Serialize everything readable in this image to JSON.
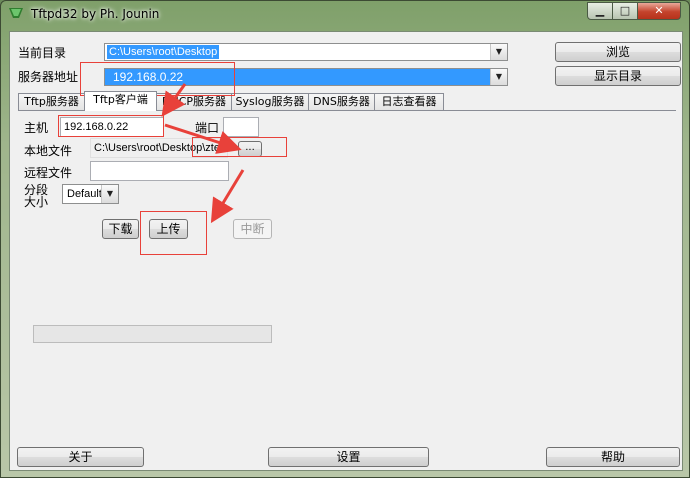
{
  "window": {
    "title": "Tftpd32 by Ph. Jounin"
  },
  "titlebar": {
    "minimize": "▁",
    "maximize": "□",
    "close": "✕"
  },
  "colors": {
    "selection": "#3399ff",
    "annotation": "#e8413a"
  },
  "top": {
    "current_dir_label": "当前目录",
    "current_dir_value": "C:\\Users\\root\\Desktop",
    "server_addr_label": "服务器地址",
    "server_addr_value": "192.168.0.22",
    "browse_label": "浏览",
    "show_dir_label": "显示目录"
  },
  "tabs": [
    "Tftp服务器",
    "Tftp客户端",
    "DHCP服务器",
    "Syslog服务器",
    "DNS服务器",
    "日志查看器"
  ],
  "client": {
    "host_label": "主机",
    "host_value": "192.168.0.22",
    "port_label": "端口",
    "port_value": "",
    "local_file_label": "本地文件",
    "local_file_value": "C:\\Users\\root\\Desktop\\zte.h",
    "browse_dots": "...",
    "remote_file_label": "远程文件",
    "remote_file_value": "",
    "block_label_1": "分段",
    "block_label_2": "大小",
    "block_value": "Default",
    "download_label": "下载",
    "upload_label": "上传",
    "abort_label": "中断",
    "progress": 0
  },
  "bottom": {
    "about_label": "关于",
    "settings_label": "设置",
    "help_label": "帮助"
  }
}
